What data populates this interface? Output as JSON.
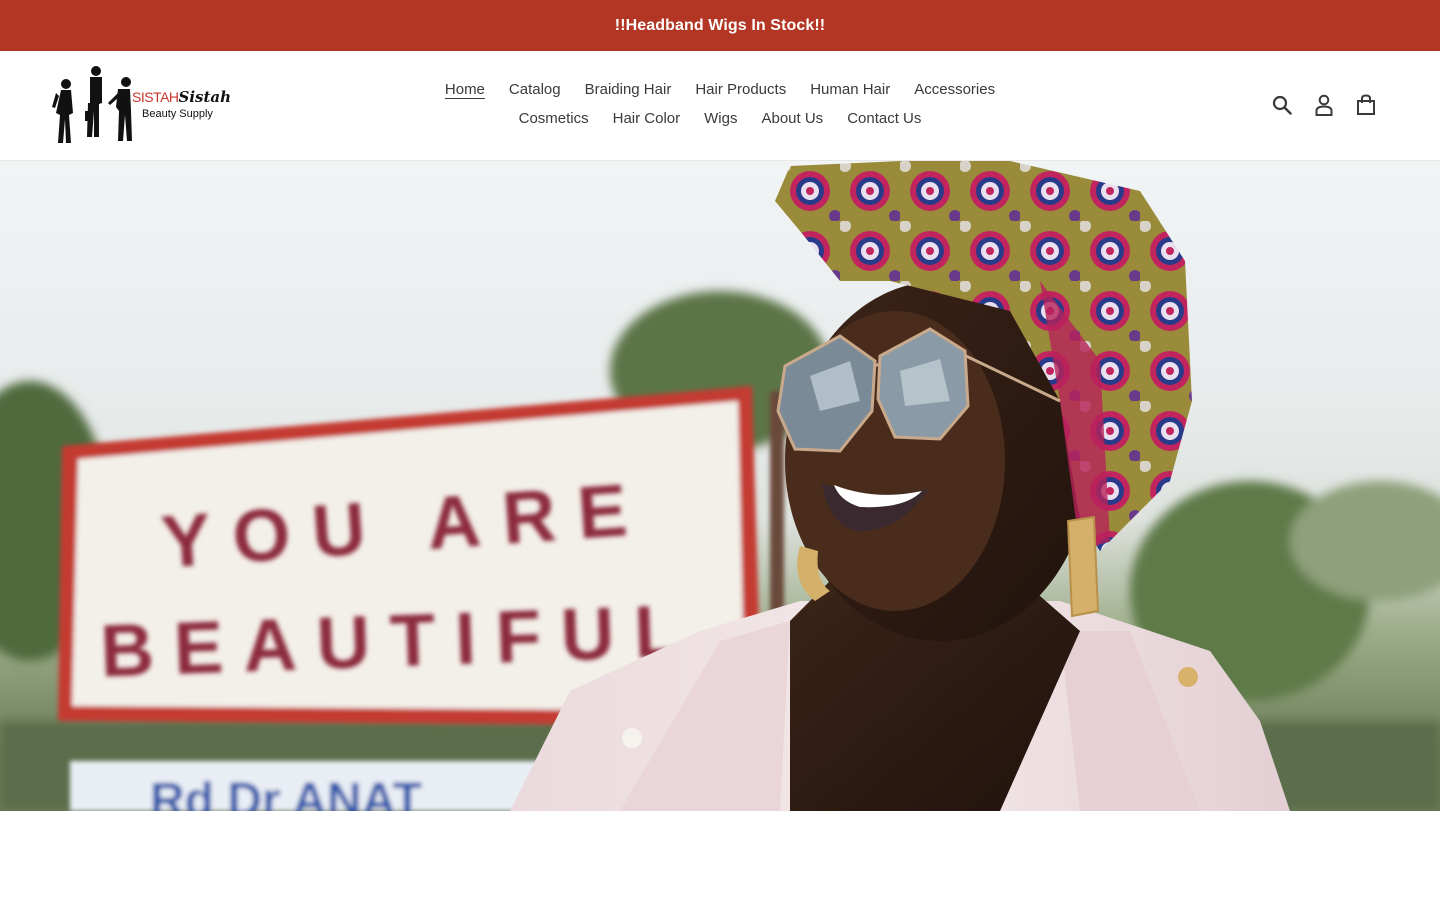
{
  "announcement": {
    "text": "!!Headband Wigs In Stock!!"
  },
  "brand": {
    "logo_red": "SISTAH",
    "logo_script": "Sistah",
    "logo_sub": "Beauty Supply"
  },
  "nav": {
    "row1": [
      {
        "label": "Home",
        "active": true
      },
      {
        "label": "Catalog"
      },
      {
        "label": "Braiding Hair"
      },
      {
        "label": "Hair Products"
      },
      {
        "label": "Human Hair"
      },
      {
        "label": "Accessories"
      }
    ],
    "row2": [
      {
        "label": "Cosmetics"
      },
      {
        "label": "Hair Color"
      },
      {
        "label": "Wigs"
      },
      {
        "label": "About Us"
      },
      {
        "label": "Contact Us"
      }
    ]
  },
  "icons": {
    "search": "search-icon",
    "account": "account-icon",
    "cart": "cart-icon"
  },
  "hero": {
    "sign_line1": "YOU ARE",
    "sign_line2": "BEAUTIFUL"
  },
  "colors": {
    "announcement_bg": "#b33624",
    "sign_text": "#8c2a3c",
    "sign_border": "#c43a32"
  }
}
